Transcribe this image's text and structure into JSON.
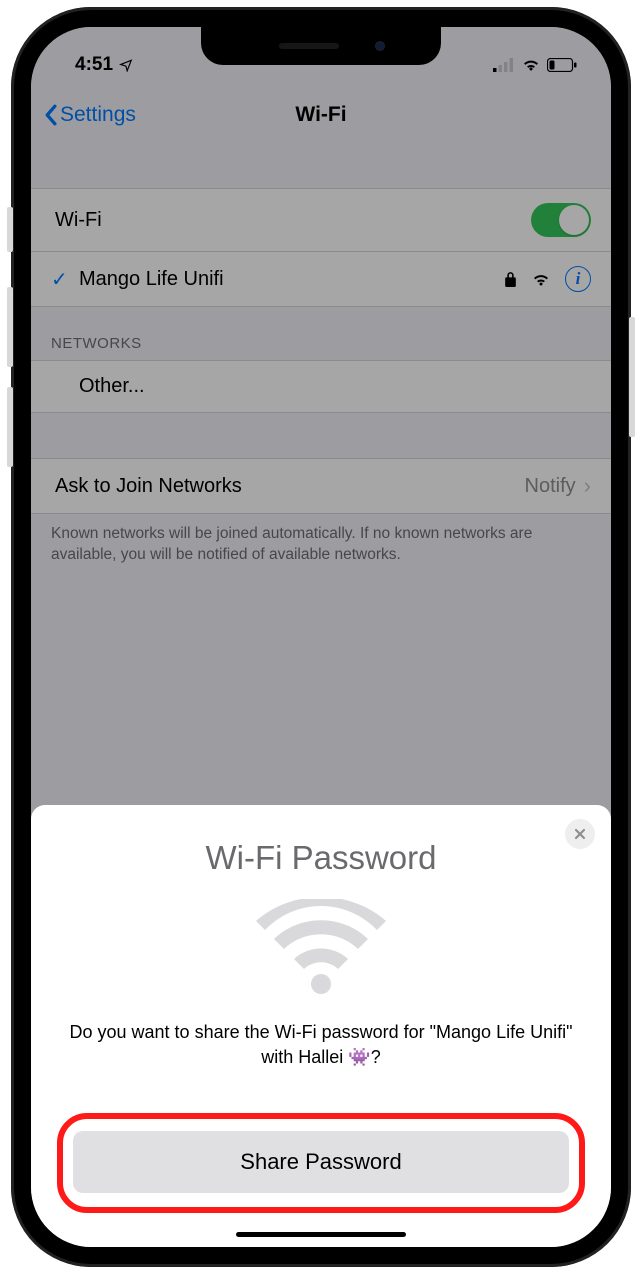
{
  "status": {
    "time": "4:51",
    "location_arrow": "↗"
  },
  "nav": {
    "back_label": "Settings",
    "title": "Wi-Fi"
  },
  "wifi": {
    "toggle_label": "Wi-Fi",
    "toggle_on": true,
    "connected_network": "Mango Life Unifi"
  },
  "sections": {
    "networks_header": "NETWORKS",
    "other_label": "Other..."
  },
  "ask_join": {
    "label": "Ask to Join Networks",
    "value": "Notify"
  },
  "footer": "Known networks will be joined automatically. If no known networks are available, you will be notified of available networks.",
  "sheet": {
    "title": "Wi-Fi Password",
    "body": "Do you want to share the Wi-Fi password for \"Mango Life Unifi\" with Hallei 👾?",
    "share_button": "Share Password"
  }
}
